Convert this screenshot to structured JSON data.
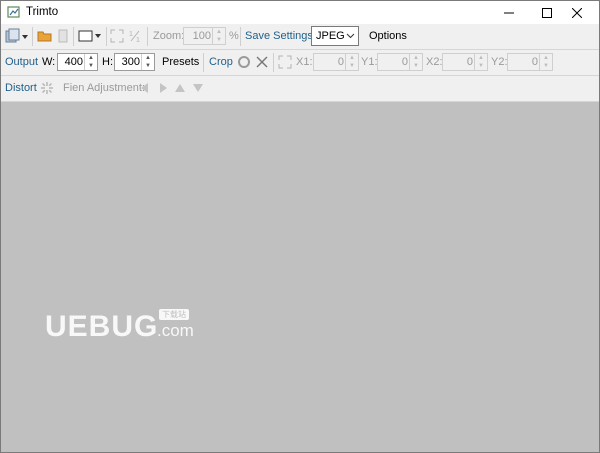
{
  "window": {
    "title": "Trimto"
  },
  "toolbar1": {
    "zoom_label": "Zoom:",
    "zoom_value": "100",
    "zoom_unit": "%",
    "save_settings_label": "Save Settings",
    "format_value": "JPEG",
    "options_label": "Options"
  },
  "toolbar2": {
    "output_label": "Output",
    "w_label": "W:",
    "w_value": "400",
    "h_label": "H:",
    "h_value": "300",
    "presets_label": "Presets",
    "crop_label": "Crop",
    "x1_label": "X1:",
    "x1_value": "0",
    "y1_label": "Y1:",
    "y1_value": "0",
    "x2_label": "X2:",
    "x2_value": "0",
    "y2_label": "Y2:",
    "y2_value": "0"
  },
  "toolbar3": {
    "distort_label": "Distort",
    "fine_adjustment_label": "Fien Adjustment:"
  },
  "watermark": {
    "text": "UEBUG",
    "suffix": ".com",
    "badge": "下载站"
  },
  "colors": {
    "accent": "#1f5f8a",
    "canvas": "#c0c0c0",
    "folder": "#e8a33a"
  }
}
